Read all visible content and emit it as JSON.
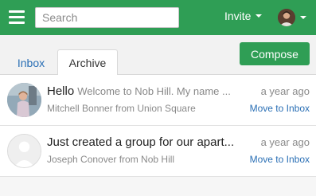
{
  "topbar": {
    "search_placeholder": "Search",
    "invite_label": "Invite",
    "brand_color": "#2f9e55"
  },
  "tabs": [
    {
      "label": "Inbox",
      "active": false
    },
    {
      "label": "Archive",
      "active": true
    }
  ],
  "compose_label": "Compose",
  "messages": [
    {
      "title": "Hello",
      "snippet": "Welcome to Nob Hill. My name ...",
      "from": "Mitchell Bonner from Union Square",
      "time": "a year ago",
      "action": "Move to Inbox",
      "avatar": "photo"
    },
    {
      "title": "Just created a group for our apart...",
      "snippet": "",
      "from": "Joseph Conover from Nob Hill",
      "time": "a year ago",
      "action": "Move to Inbox",
      "avatar": "placeholder-person-icon"
    }
  ]
}
